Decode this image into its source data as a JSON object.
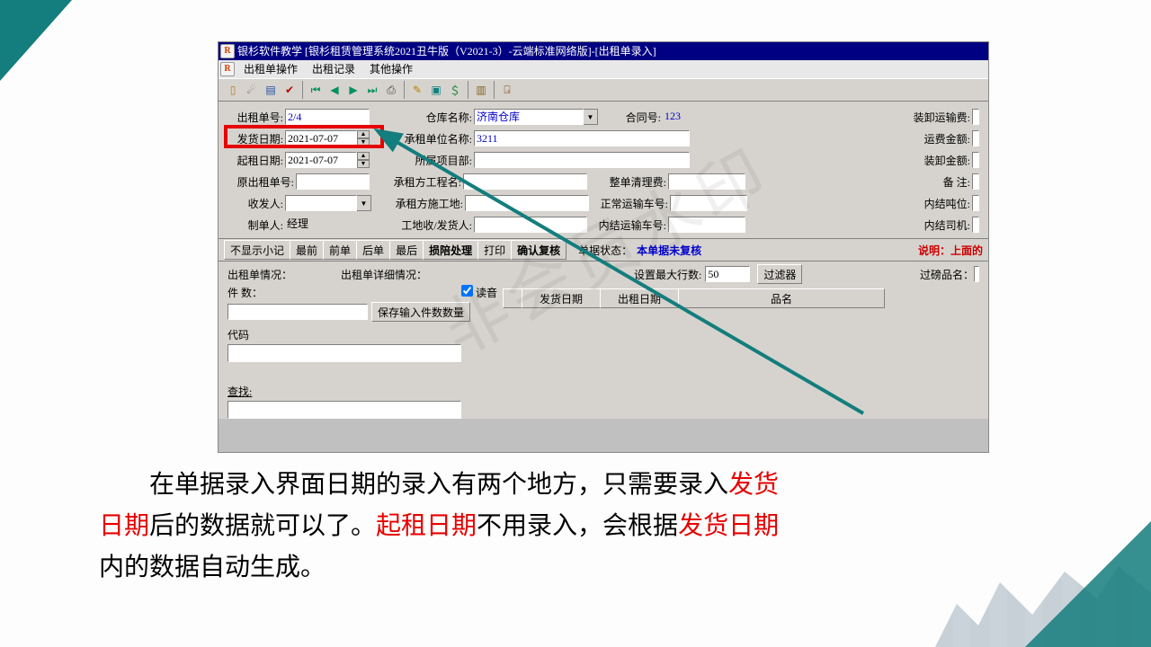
{
  "title": "银杉软件教学   [银杉租赁管理系统2021丑牛版（V2021-3）-云端标准网络版]-[出租单录入]",
  "menus": [
    "出租单操作",
    "出租记录",
    "其他操作"
  ],
  "form": {
    "order_no": {
      "label": "出租单号:",
      "value": "2/4"
    },
    "ship_date": {
      "label": "发货日期:",
      "value": "2021-07-07"
    },
    "rent_date": {
      "label": "起租日期:",
      "value": "2021-07-07"
    },
    "orig_no": {
      "label": "原出租单号:"
    },
    "handler": {
      "label": "收发人:"
    },
    "creator": {
      "label": "制单人:",
      "value": "经理"
    },
    "warehouse": {
      "label": "仓库名称:",
      "value": "济南仓库"
    },
    "lessee": {
      "label": "承租单位名称:",
      "value": "3211"
    },
    "project": {
      "label": "所属项目部:"
    },
    "proj_name": {
      "label": "承租方工程名:"
    },
    "site": {
      "label": "承租方施工地:"
    },
    "site_send": {
      "label": "工地收/发货人:"
    },
    "contract": {
      "label": "合同号:",
      "value": "123"
    },
    "clean": {
      "label": "整单清理费:"
    },
    "truck": {
      "label": "正常运输车号:"
    },
    "in_truck": {
      "label": "内结运输车号:"
    },
    "load_fee": {
      "label": "装卸运输费:"
    },
    "freight": {
      "label": "运费金额:"
    },
    "load_amt": {
      "label": "装卸金额:"
    },
    "remark": {
      "label": "备   注:"
    },
    "in_ton": {
      "label": "内结吨位:"
    },
    "in_driver": {
      "label": "内结司机:"
    }
  },
  "buttons_row": [
    "不显示小记",
    "最前",
    "前单",
    "后单",
    "最后",
    "损陪处理",
    "打印",
    "确认复核"
  ],
  "status": {
    "label": "单据状态：",
    "value": "本单据未复核"
  },
  "hint": "说明：上面的",
  "lower": {
    "situation": "出租单情况：",
    "detail": "出租单详细情况：",
    "pieces": "件  数：",
    "save_btn": "保存输入件数数量",
    "read": "读音",
    "code": "代码",
    "search": "查找:",
    "maxrow_lbl": "设置最大行数:",
    "maxrow_val": "50",
    "filter": "过滤器",
    "weigh": "过磅品名："
  },
  "grid_cols": [
    "发货日期",
    "出租日期",
    "品名"
  ],
  "explain": {
    "p1a": "在单据录入界面日期的录入有两个地方，只需要录入",
    "p1b": "发货日期",
    "p2a": "后的数据就可以了。",
    "p2b": "起租日期",
    "p2c": "不用录入，会根据",
    "p2d": "发货日期",
    "p3": "内的数据自动生成。"
  }
}
